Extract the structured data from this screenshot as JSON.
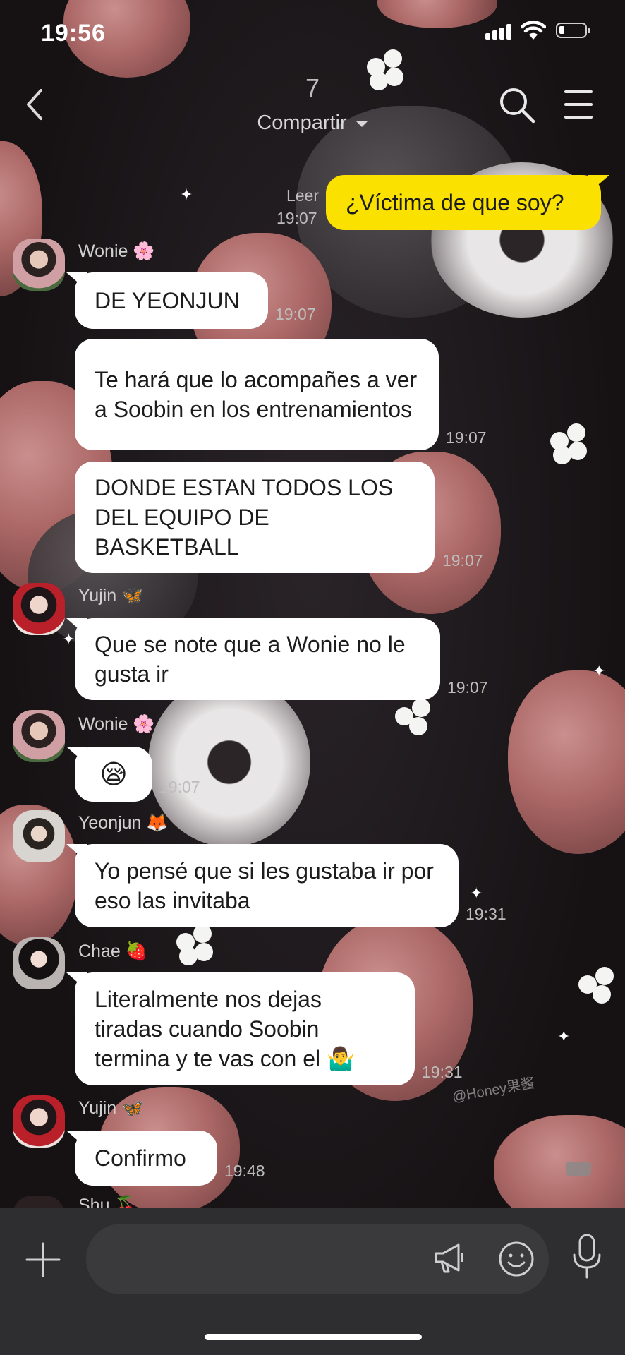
{
  "status_bar": {
    "time": "19:56"
  },
  "header": {
    "participant_count": "7",
    "share_label": "Compartir"
  },
  "messages": [
    {
      "sender": "me",
      "text": "¿Víctima de que soy?",
      "read_label": "Leer",
      "time": "19:07"
    },
    {
      "sender": "Wonie 🌸",
      "text": "DE YEONJUN",
      "time": "19:07"
    },
    {
      "sender": "Wonie 🌸",
      "text": "Te hará que lo acompañes a ver a Soobin en los entrenamientos",
      "time": "19:07"
    },
    {
      "sender": "Wonie 🌸",
      "text": "DONDE ESTAN TODOS LOS DEL EQUIPO DE BASKETBALL",
      "time": "19:07"
    },
    {
      "sender": "Yujin 🦋",
      "text": "Que se note que a Wonie no le gusta ir",
      "time": "19:07"
    },
    {
      "sender": "Wonie 🌸",
      "text": "😪",
      "time": "19:07"
    },
    {
      "sender": "Yeonjun 🦊",
      "text": "Yo pensé que si les gustaba ir por eso las invitaba",
      "time": "19:31"
    },
    {
      "sender": "Chae 🍓",
      "text": "Literalmente nos dejas tiradas cuando Soobin termina y te vas con el 🤷‍♂️",
      "time": "19:31"
    },
    {
      "sender": "Yujin 🦋",
      "text": "Confirmo",
      "time": "19:48"
    },
    {
      "sender": "Shu 🍒",
      "text": "",
      "time": ""
    }
  ],
  "watermark": "@Honey果酱",
  "icons": {
    "back": "chevron-left-icon",
    "search": "search-icon",
    "menu": "hamburger-menu-icon",
    "attach": "plus-icon",
    "shout": "megaphone-icon",
    "emoticon": "smile-icon",
    "voice": "microphone-icon"
  },
  "colors": {
    "my_bubble": "#fae100",
    "other_bubble": "#ffffff",
    "input_bar": "#2e2e30"
  }
}
